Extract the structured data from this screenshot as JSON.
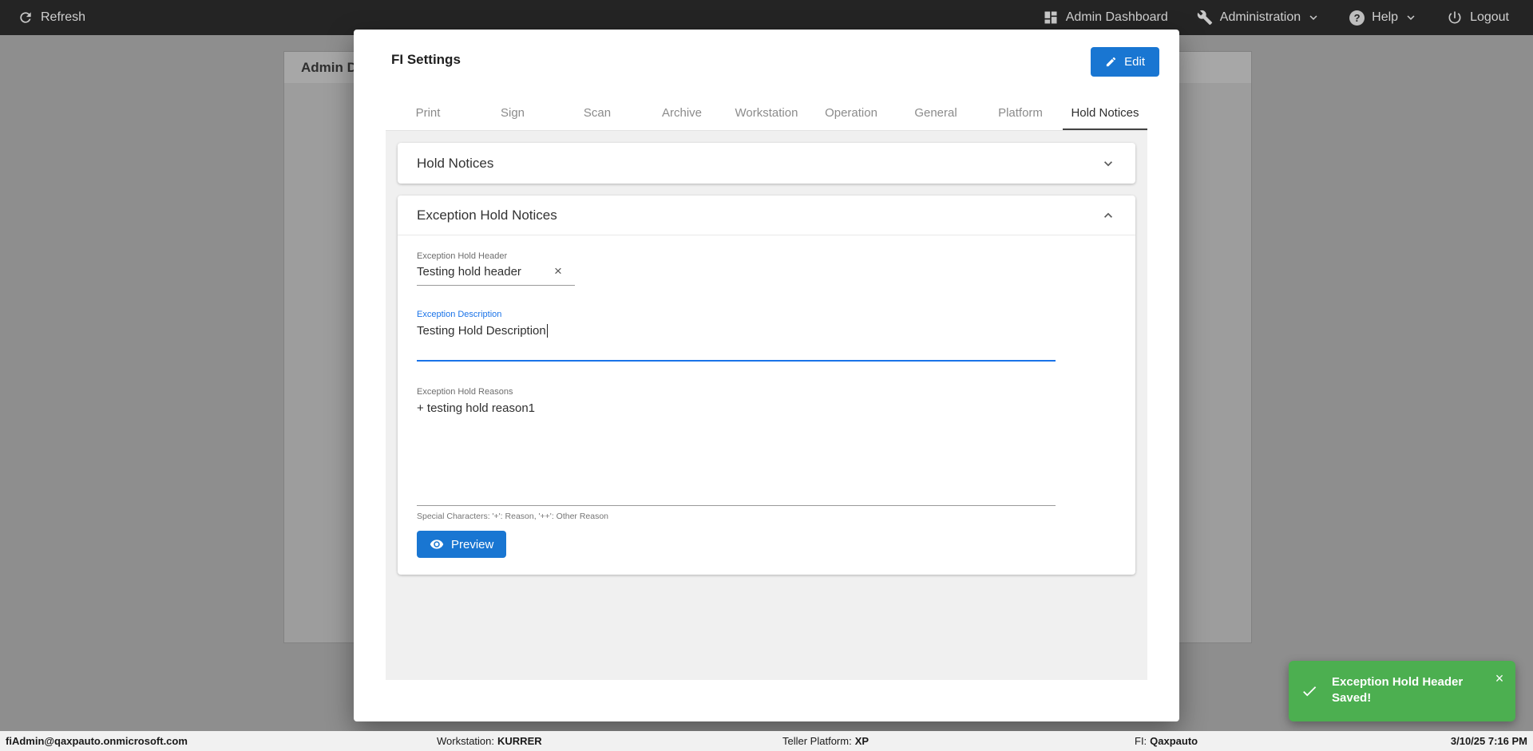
{
  "topbar": {
    "refresh": "Refresh",
    "admin_dashboard": "Admin Dashboard",
    "administration": "Administration",
    "help": "Help",
    "logout": "Logout"
  },
  "background_page": {
    "panel_title": "Admin D"
  },
  "modal": {
    "title": "FI Settings",
    "edit_button": "Edit",
    "tabs": [
      {
        "label": "Print",
        "active": false
      },
      {
        "label": "Sign",
        "active": false
      },
      {
        "label": "Scan",
        "active": false
      },
      {
        "label": "Archive",
        "active": false
      },
      {
        "label": "Workstation",
        "active": false
      },
      {
        "label": "Operation",
        "active": false
      },
      {
        "label": "General",
        "active": false
      },
      {
        "label": "Platform",
        "active": false
      },
      {
        "label": "Hold Notices",
        "active": true
      }
    ],
    "hold_notices_card": {
      "title": "Hold Notices"
    },
    "exception_card": {
      "title": "Exception Hold Notices",
      "header_field": {
        "label": "Exception Hold Header",
        "value": "Testing hold header",
        "clear_icon": "×"
      },
      "description_field": {
        "label": "Exception Description",
        "value": "Testing Hold Description"
      },
      "reasons_field": {
        "label": "Exception Hold Reasons",
        "value": "+ testing hold reason1",
        "helper": "Special Characters: '+': Reason, '++': Other Reason"
      },
      "preview_button": "Preview"
    }
  },
  "toast": {
    "message": "Exception Hold Header Saved!",
    "close_icon": "×"
  },
  "footer": {
    "user": "fiAdmin@qaxpauto.onmicrosoft.com",
    "workstation_label": "Workstation:",
    "workstation_value": "KURRER",
    "platform_label": "Teller Platform:",
    "platform_value": "XP",
    "fi_label": "FI:",
    "fi_value": "Qaxpauto",
    "datetime": "3/10/25 7:16 PM"
  },
  "colors": {
    "accent_blue": "#1976d2",
    "focused_field_blue": "#1a73e8",
    "toast_green": "#4caf50",
    "topbar_bg": "#242424"
  }
}
